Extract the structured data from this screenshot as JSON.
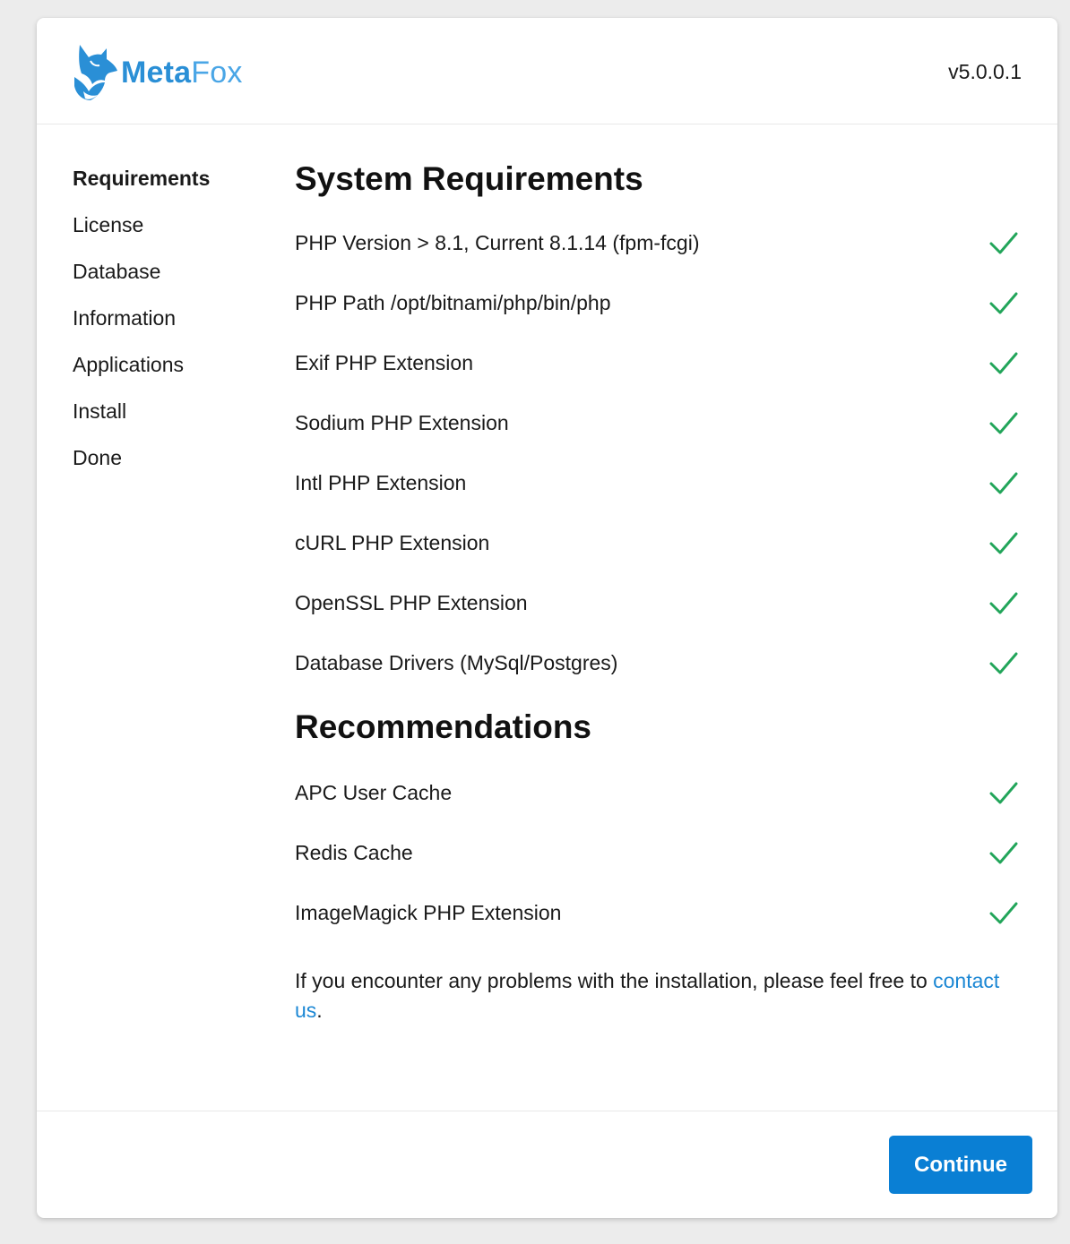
{
  "brand": {
    "logo_part1": "Meta",
    "logo_part2": "Fox",
    "primary_color": "#2a8fd6",
    "accent_color": "#0a7fd4"
  },
  "header": {
    "version": "v5.0.0.1"
  },
  "sidebar": {
    "items": [
      {
        "label": "Requirements",
        "active": true
      },
      {
        "label": "License",
        "active": false
      },
      {
        "label": "Database",
        "active": false
      },
      {
        "label": "Information",
        "active": false
      },
      {
        "label": "Applications",
        "active": false
      },
      {
        "label": "Install",
        "active": false
      },
      {
        "label": "Done",
        "active": false
      }
    ]
  },
  "requirements": {
    "title": "System Requirements",
    "items": [
      {
        "label": "PHP Version > 8.1, Current 8.1.14 (fpm-fcgi)",
        "status": "check-icon"
      },
      {
        "label": "PHP Path /opt/bitnami/php/bin/php",
        "status": "check-icon"
      },
      {
        "label": "Exif PHP Extension",
        "status": "check-icon"
      },
      {
        "label": "Sodium PHP Extension",
        "status": "check-icon"
      },
      {
        "label": "Intl PHP Extension",
        "status": "check-icon"
      },
      {
        "label": "cURL PHP Extension",
        "status": "check-icon"
      },
      {
        "label": "OpenSSL PHP Extension",
        "status": "check-icon"
      },
      {
        "label": "Database Drivers (MySql/Postgres)",
        "status": "check-icon"
      }
    ]
  },
  "recommendations": {
    "title": "Recommendations",
    "items": [
      {
        "label": "APC User Cache",
        "status": "check-icon"
      },
      {
        "label": "Redis Cache",
        "status": "check-icon"
      },
      {
        "label": "ImageMagick PHP Extension",
        "status": "check-icon"
      }
    ]
  },
  "help": {
    "text": "If you encounter any problems with the installation, please feel free to",
    "link_label": "contact us",
    "suffix": "."
  },
  "footer": {
    "continue_label": "Continue"
  },
  "colors": {
    "check": "#22a55a",
    "link": "#1b87d4"
  }
}
